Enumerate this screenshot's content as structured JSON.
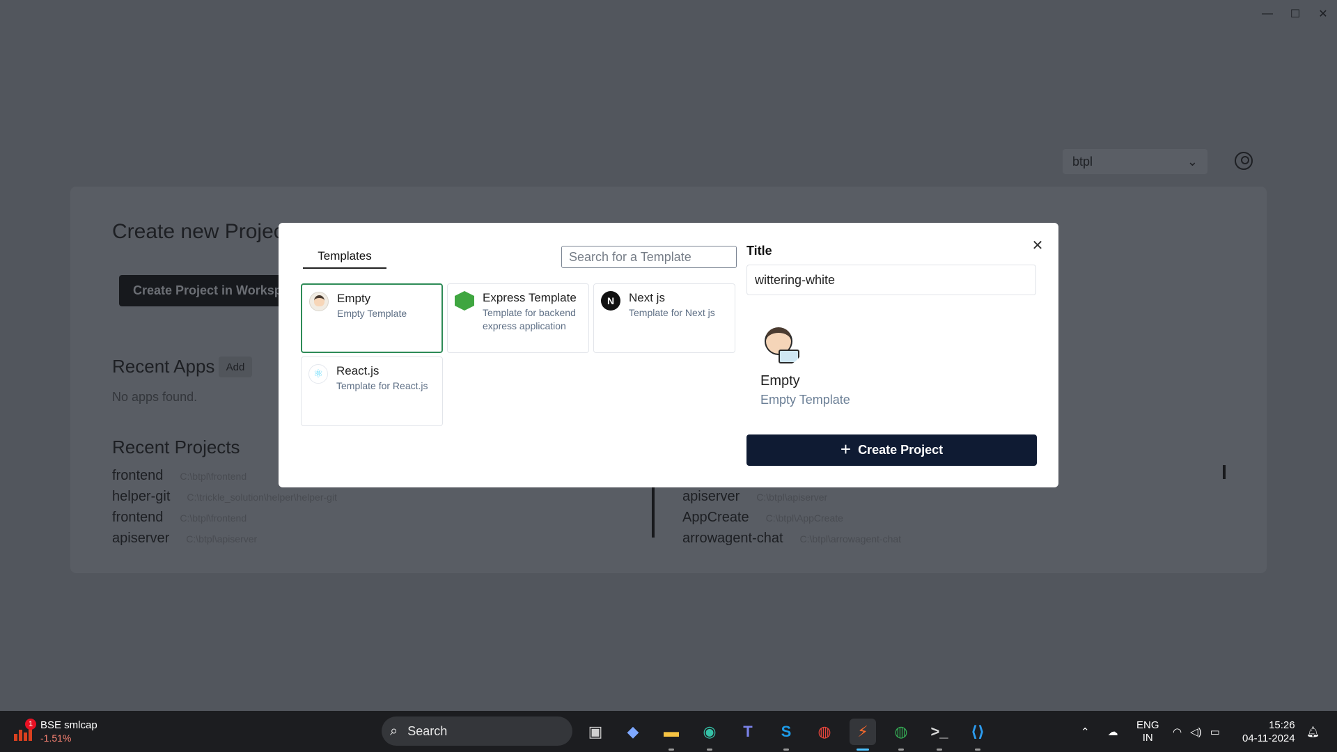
{
  "workspace": {
    "selected": "btpl"
  },
  "background": {
    "title": "Create new Project",
    "create_in_workspace": "Create Project in Workspace",
    "recent_apps_heading": "Recent Apps",
    "add_label": "Add",
    "no_apps": "No apps found.",
    "recent_projects_heading": "Recent Projects",
    "projects_left": [
      {
        "name": "frontend",
        "path": "C:\\btpl\\frontend"
      },
      {
        "name": "helper-git",
        "path": "C:\\trickle_solution\\helper\\helper-git"
      },
      {
        "name": "frontend",
        "path": "C:\\btpl\\frontend"
      },
      {
        "name": "apiserver",
        "path": "C:\\btpl\\apiserver"
      }
    ],
    "projects_right": [
      {
        "name": "apiserver",
        "path": "C:\\btpl\\apiserver"
      },
      {
        "name": "AppCreate",
        "path": "C:\\btpl\\AppCreate"
      },
      {
        "name": "arrowagent-chat",
        "path": "C:\\btpl\\arrowagent-chat"
      }
    ]
  },
  "modal": {
    "tab_label": "Templates",
    "search_placeholder": "Search for a Template",
    "templates": [
      {
        "title": "Empty",
        "desc": "Empty Template",
        "icon": "avatar-icon"
      },
      {
        "title": "Express Template",
        "desc": "Template for backend express application",
        "icon": "nodejs-icon"
      },
      {
        "title": "Next js",
        "desc": "Template for Next js",
        "icon": "nextjs-icon",
        "glyph": "N"
      },
      {
        "title": "React.js",
        "desc": "Template for React.js",
        "icon": "react-icon",
        "glyph": "⚛"
      }
    ],
    "title_label": "Title",
    "title_value": "wittering-white",
    "preview": {
      "name": "Empty",
      "desc": "Empty Template"
    },
    "create_button": "Create Project",
    "close_glyph": "✕"
  },
  "taskbar": {
    "stock": {
      "name": "BSE smlcap",
      "change": "-1.51%",
      "badge": "1"
    },
    "search_label": "Search",
    "apps": [
      {
        "name": "task-view-icon",
        "glyph": "▣",
        "color": "#d0d0d0"
      },
      {
        "name": "copilot-icon",
        "glyph": "◆",
        "color": "#7ea8ff"
      },
      {
        "name": "file-explorer-icon",
        "glyph": "▬",
        "color": "#f6c343"
      },
      {
        "name": "edge-icon",
        "glyph": "◉",
        "color": "#35c1a6"
      },
      {
        "name": "teams-icon",
        "glyph": "T",
        "color": "#7b83eb"
      },
      {
        "name": "skype-icon",
        "glyph": "S",
        "color": "#1d9be8"
      },
      {
        "name": "chrome-icon",
        "glyph": "◍",
        "color": "#e8453c"
      },
      {
        "name": "app-bolt-icon",
        "glyph": "⚡",
        "color": "#ff6a2b"
      },
      {
        "name": "chrome-profile-icon",
        "glyph": "◍",
        "color": "#34a853"
      },
      {
        "name": "terminal-icon",
        "glyph": ">_",
        "color": "#d8d8d8"
      },
      {
        "name": "vscode-icon",
        "glyph": "⟨⟩",
        "color": "#2c9cf0"
      }
    ],
    "lang_line1": "ENG",
    "lang_line2": "IN",
    "time": "15:26",
    "date": "04-11-2024"
  }
}
